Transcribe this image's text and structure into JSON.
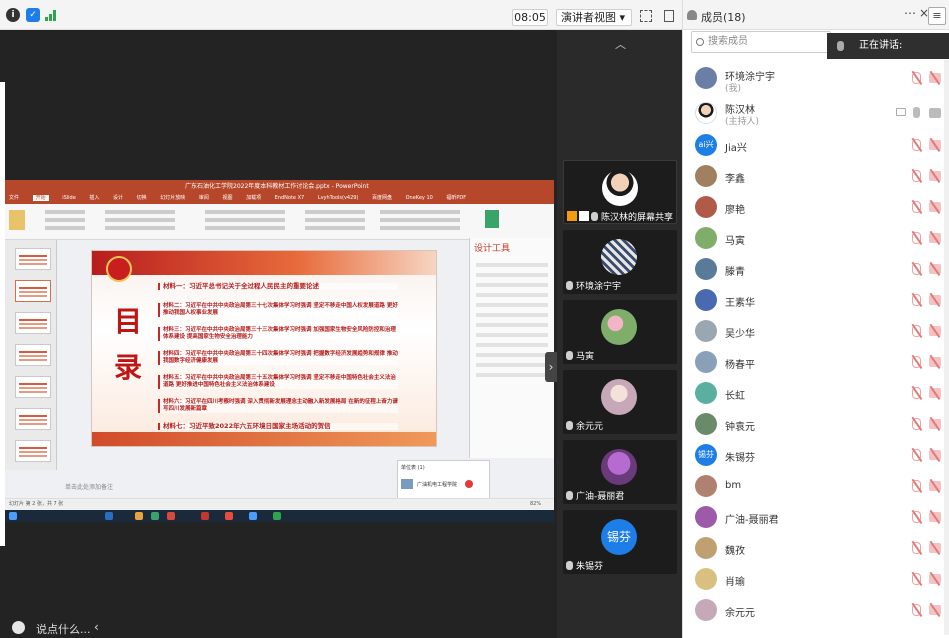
{
  "topbar": {
    "time": "08:05",
    "view_label": "演讲者视图 ▾"
  },
  "shared_screen": {
    "window_title": "广东石油化工学院2022年度本科教材工作讨论会.pptx - PowerPoint",
    "ribbon_tabs": [
      "文件",
      "开始",
      "iSlide",
      "插入",
      "设计",
      "切换",
      "幻灯片放映",
      "审阅",
      "视图",
      "加载项",
      "EndNote X7",
      "LvyhTools(v429)",
      "百度网盘",
      "OneKey 10",
      "福昕PDF"
    ],
    "slide": {
      "heading": "目\n录",
      "materials": [
        "材料一：习近平总书记关于全过程人民民主的重要论述",
        "材料二：习近平在中共中央政治局第三十七次集体学习时强调 坚定不移走中国人权发展道路 更好推动我国人权事业发展",
        "材料三：习近平在中共中央政治局第三十三次集体学习时强调 加强国家生物安全风险防控和治理体系建设 提高国家生物安全治理能力",
        "材料四：习近平在中共中央政治局第三十四次集体学习时强调 把握数字经济发展趋势和规律 推动我国数字经济健康发展",
        "材料五：习近平在中共中央政治局第三十五次集体学习时强调 坚定不移走中国特色社会主义法治道路 更好推进中国特色社会主义法治体系建设",
        "材料六：习近平在四川考察时强调 深入贯彻新发展理念主动融入新发展格局 在新的征程上奋力谱写四川发展新篇章",
        "材料七：习近平致2022年六五环境日国家主场活动的贺信"
      ]
    },
    "design_pane_title": "设计工具",
    "notes_placeholder": "单击此处添加备注",
    "status_left": "幻灯片 第 2 张，共 7 张",
    "popup_title": "单位表 (1)",
    "popup_item": "广油机电工程学院",
    "zoom": "82%"
  },
  "bottom": {
    "say_something": "说点什么..."
  },
  "video_tiles": [
    {
      "name": "陈汉林的屏幕共享",
      "color": "#3a3a3a",
      "active": true
    },
    {
      "name": "环境涂宁宇",
      "color": "#7a8fb5"
    },
    {
      "name": "马寅",
      "color": "#7fae6a"
    },
    {
      "name": "余元元",
      "color": "#c7a8b9"
    },
    {
      "name": "广油-聂丽君",
      "color": "#9c5aa8"
    },
    {
      "name": "朱锡芬",
      "color": "#1e7ee8",
      "initials": "锡芬"
    }
  ],
  "members": {
    "title": "成员(18)",
    "search_placeholder": "搜索成员",
    "speaking_label": "正在讲话:",
    "list": [
      {
        "name": "环境涂宁宇",
        "sub": "(我)",
        "avatar_color": "#6b7fa6",
        "initials": ""
      },
      {
        "name": "陈汉林",
        "sub": "(主持人)",
        "avatar_color": "#3d3d3d",
        "initials": ""
      },
      {
        "name": "Jia兴",
        "avatar_color": "#1e7ee8",
        "initials": "ai兴"
      },
      {
        "name": "李鑫",
        "avatar_color": "#a08060",
        "initials": ""
      },
      {
        "name": "廖艳",
        "avatar_color": "#b05a4a",
        "initials": ""
      },
      {
        "name": "马寅",
        "avatar_color": "#7fae6a",
        "initials": ""
      },
      {
        "name": "滕青",
        "avatar_color": "#5a7a9a",
        "initials": ""
      },
      {
        "name": "王素华",
        "avatar_color": "#4a6ab0",
        "initials": ""
      },
      {
        "name": "吴少华",
        "avatar_color": "#9aa6b0",
        "initials": ""
      },
      {
        "name": "杨春平",
        "avatar_color": "#8aa0b8",
        "initials": ""
      },
      {
        "name": "长虹",
        "avatar_color": "#5ab0a0",
        "initials": ""
      },
      {
        "name": "钟袁元",
        "avatar_color": "#6a8a6a",
        "initials": ""
      },
      {
        "name": "朱锡芬",
        "avatar_color": "#1e7ee8",
        "initials": "锡芬"
      },
      {
        "name": "bm",
        "avatar_color": "#b08070",
        "initials": ""
      },
      {
        "name": "广油-聂丽君",
        "avatar_color": "#9c5aa8",
        "initials": ""
      },
      {
        "name": "魏孜",
        "avatar_color": "#c0a070",
        "initials": ""
      },
      {
        "name": "肖瑜",
        "avatar_color": "#d8c080",
        "initials": ""
      },
      {
        "name": "余元元",
        "avatar_color": "#c7a8b9",
        "initials": ""
      }
    ]
  }
}
